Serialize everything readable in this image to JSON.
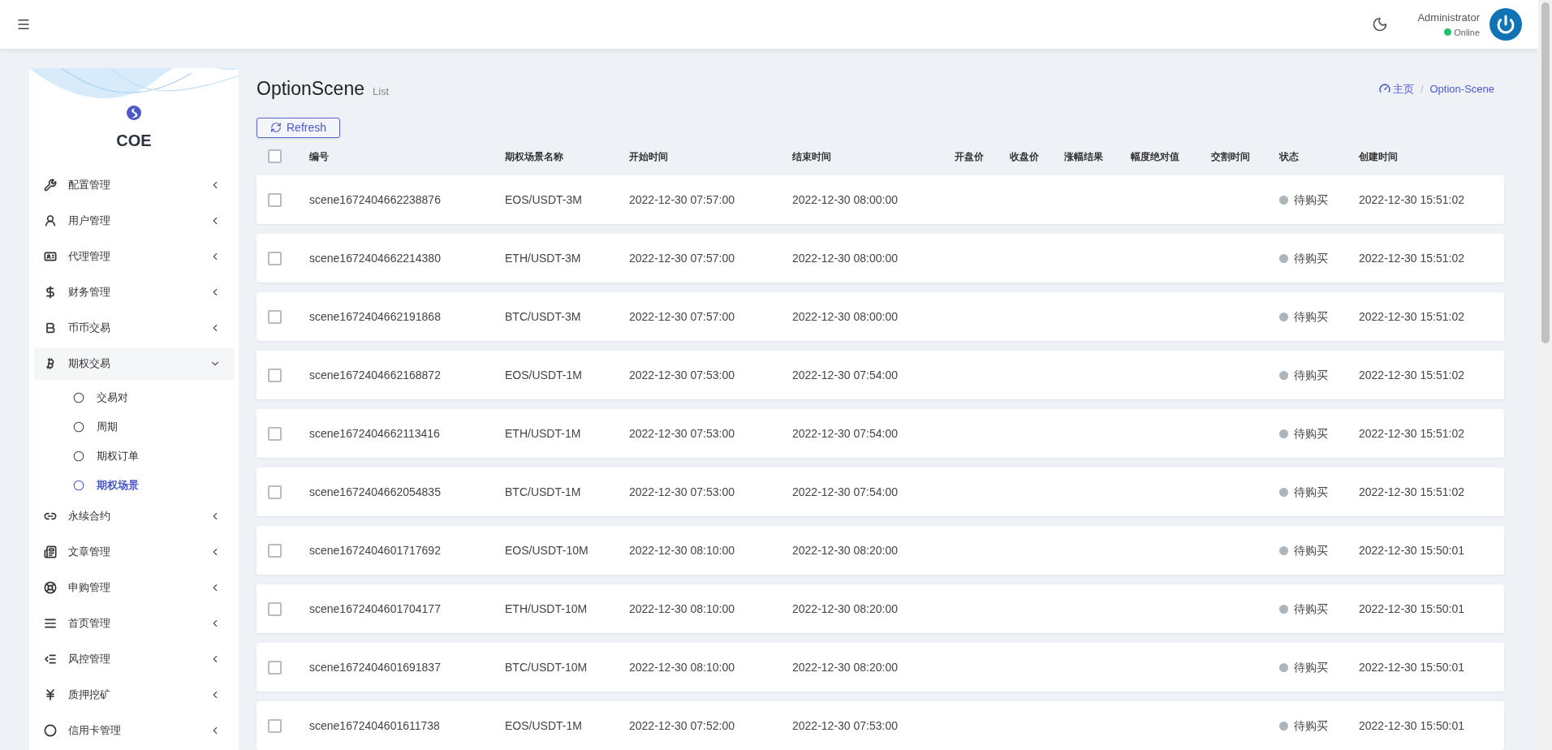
{
  "header": {
    "user_name": "Administrator",
    "user_status": "Online"
  },
  "sidebar": {
    "brand": "COE",
    "items": [
      {
        "label": "配置管理",
        "expanded": false
      },
      {
        "label": "用户管理",
        "expanded": false
      },
      {
        "label": "代理管理",
        "expanded": false
      },
      {
        "label": "财务管理",
        "expanded": false
      },
      {
        "label": "币币交易",
        "expanded": false
      },
      {
        "label": "期权交易",
        "expanded": true,
        "children": [
          {
            "label": "交易对",
            "selected": false
          },
          {
            "label": "周期",
            "selected": false
          },
          {
            "label": "期权订单",
            "selected": false
          },
          {
            "label": "期权场景",
            "selected": true
          }
        ]
      },
      {
        "label": "永续合约",
        "expanded": false
      },
      {
        "label": "文章管理",
        "expanded": false
      },
      {
        "label": "申购管理",
        "expanded": false
      },
      {
        "label": "首页管理",
        "expanded": false
      },
      {
        "label": "风控管理",
        "expanded": false
      },
      {
        "label": "质押挖矿",
        "expanded": false
      },
      {
        "label": "信用卡管理",
        "expanded": false
      }
    ]
  },
  "page": {
    "title": "OptionScene",
    "subtitle": "List",
    "breadcrumb": [
      "主页",
      "Option-Scene"
    ],
    "breadcrumb_separator": "/",
    "refresh_button": "Refresh"
  },
  "table": {
    "select_all_checked": false,
    "columns": [
      "编号",
      "期权场景名称",
      "开始时间",
      "结束时间",
      "开盘价",
      "收盘价",
      "涨幅结果",
      "幅度绝对值",
      "交割时间",
      "状态",
      "创建时间"
    ],
    "rows": [
      {
        "checked": false,
        "id": "scene1672404662238876",
        "name": "EOS/USDT-3M",
        "start": "2022-12-30 07:57:00",
        "end": "2022-12-30 08:00:00",
        "status": "待购买",
        "color": "#adb5bd",
        "created": "2022-12-30 15:51:02"
      },
      {
        "checked": false,
        "id": "scene1672404662214380",
        "name": "ETH/USDT-3M",
        "start": "2022-12-30 07:57:00",
        "end": "2022-12-30 08:00:00",
        "status": "待购买",
        "color": "#adb5bd",
        "created": "2022-12-30 15:51:02"
      },
      {
        "checked": false,
        "id": "scene1672404662191868",
        "name": "BTC/USDT-3M",
        "start": "2022-12-30 07:57:00",
        "end": "2022-12-30 08:00:00",
        "status": "待购买",
        "color": "#adb5bd",
        "created": "2022-12-30 15:51:02"
      },
      {
        "checked": false,
        "id": "scene1672404662168872",
        "name": "EOS/USDT-1M",
        "start": "2022-12-30 07:53:00",
        "end": "2022-12-30 07:54:00",
        "status": "待购买",
        "color": "#adb5bd",
        "created": "2022-12-30 15:51:02"
      },
      {
        "checked": false,
        "id": "scene1672404662113416",
        "name": "ETH/USDT-1M",
        "start": "2022-12-30 07:53:00",
        "end": "2022-12-30 07:54:00",
        "status": "待购买",
        "color": "#adb5bd",
        "created": "2022-12-30 15:51:02"
      },
      {
        "checked": false,
        "id": "scene1672404662054835",
        "name": "BTC/USDT-1M",
        "start": "2022-12-30 07:53:00",
        "end": "2022-12-30 07:54:00",
        "status": "待购买",
        "color": "#adb5bd",
        "created": "2022-12-30 15:51:02"
      },
      {
        "checked": false,
        "id": "scene1672404601717692",
        "name": "EOS/USDT-10M",
        "start": "2022-12-30 08:10:00",
        "end": "2022-12-30 08:20:00",
        "status": "待购买",
        "color": "#adb5bd",
        "created": "2022-12-30 15:50:01"
      },
      {
        "checked": false,
        "id": "scene1672404601704177",
        "name": "ETH/USDT-10M",
        "start": "2022-12-30 08:10:00",
        "end": "2022-12-30 08:20:00",
        "status": "待购买",
        "color": "#adb5bd",
        "created": "2022-12-30 15:50:01"
      },
      {
        "checked": false,
        "id": "scene1672404601691837",
        "name": "BTC/USDT-10M",
        "start": "2022-12-30 08:10:00",
        "end": "2022-12-30 08:20:00",
        "status": "待购买",
        "color": "#adb5bd",
        "created": "2022-12-30 15:50:01"
      },
      {
        "checked": false,
        "id": "scene1672404601611738",
        "name": "EOS/USDT-1M",
        "start": "2022-12-30 07:52:00",
        "end": "2022-12-30 07:53:00",
        "status": "待购买",
        "color": "#adb5bd",
        "created": "2022-12-30 15:50:01"
      }
    ]
  }
}
